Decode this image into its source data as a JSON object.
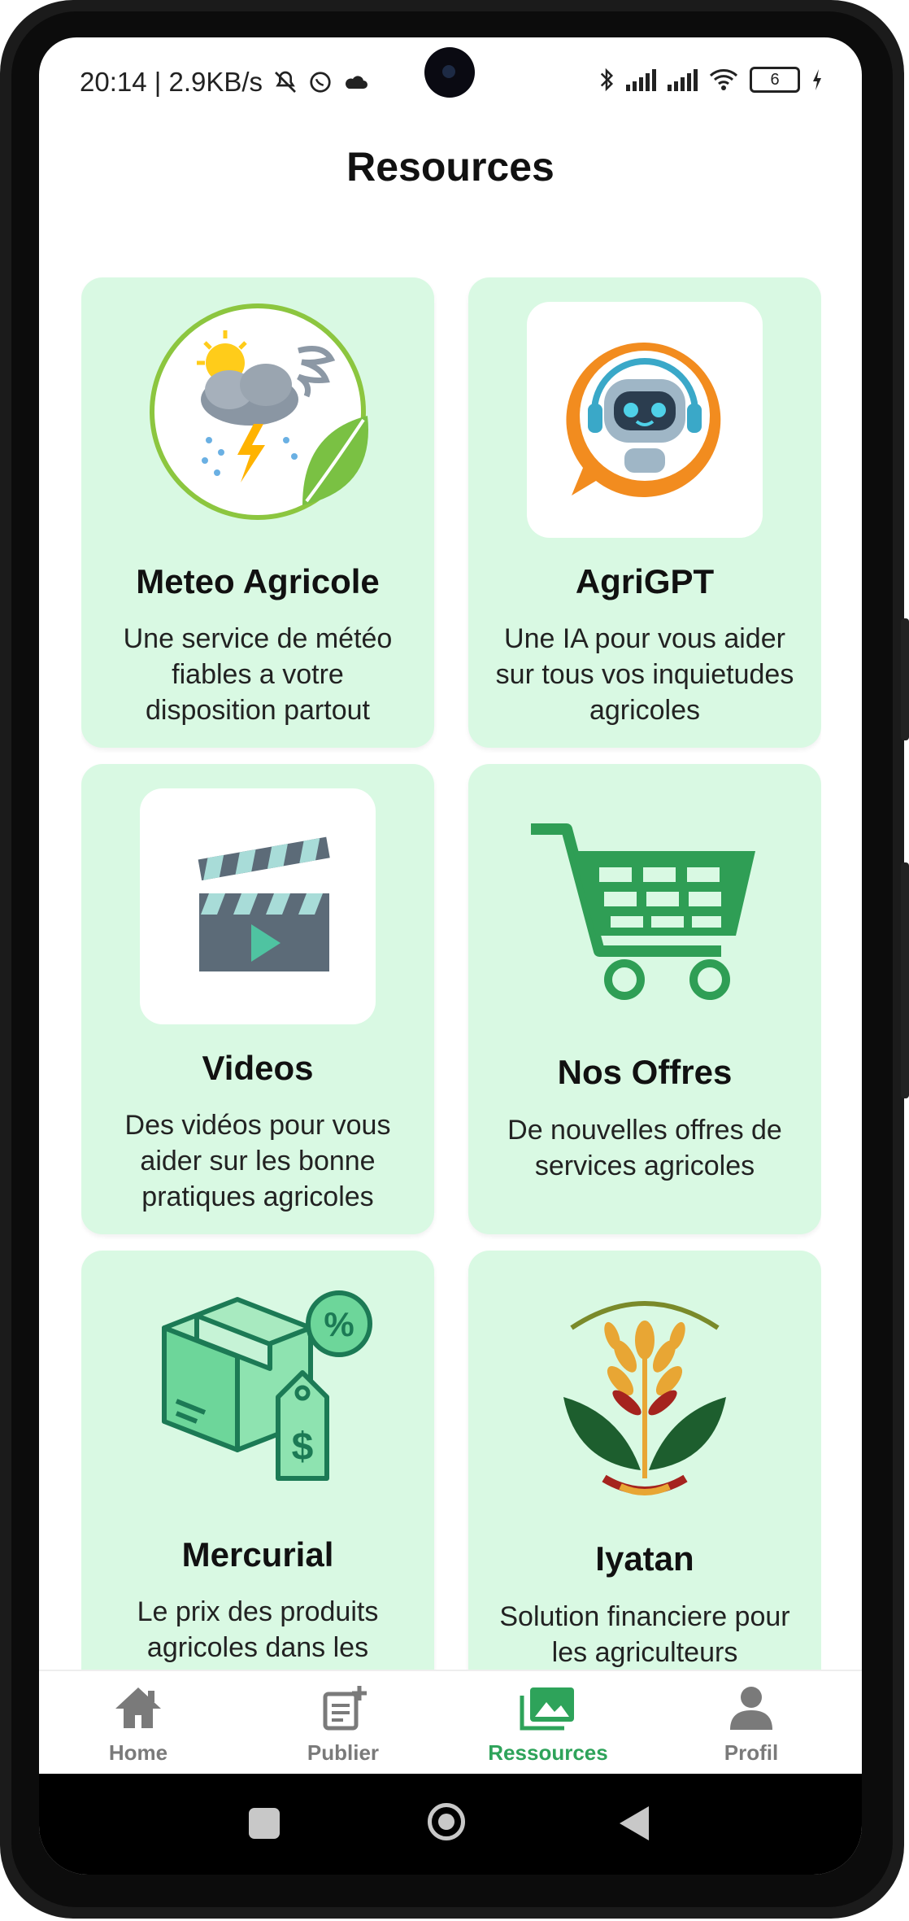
{
  "status_bar": {
    "time_speed": "20:14 | 2.9KB/s",
    "battery": "6",
    "icons": [
      "mute-icon",
      "whatsapp-icon",
      "cloud-icon",
      "bluetooth-icon",
      "signal-icon",
      "signal-icon",
      "wifi-icon",
      "battery-icon",
      "charging-icon"
    ]
  },
  "header": {
    "title": "Resources"
  },
  "cards": [
    {
      "title": "Meteo Agricole",
      "desc": "Une service de météo fiables a votre disposition partout",
      "icon": "weather-leaf-icon"
    },
    {
      "title": "AgriGPT",
      "desc": "Une IA pour vous aider sur tous vos inquietudes agricoles",
      "icon": "robot-assistant-icon"
    },
    {
      "title": "Videos",
      "desc": "Des vidéos pour vous aider sur les bonne pratiques agricoles",
      "icon": "clapperboard-icon"
    },
    {
      "title": "Nos Offres",
      "desc": "De nouvelles offres de services agricoles",
      "icon": "shopping-cart-icon"
    },
    {
      "title": "Mercurial",
      "desc": "Le prix des produits agricoles dans les marchés publics",
      "icon": "package-price-icon"
    },
    {
      "title": "Iyatan",
      "desc": "Solution financiere pour les agriculteurs",
      "icon": "wheat-logo-icon"
    }
  ],
  "bottom_nav": {
    "items": [
      {
        "label": "Home",
        "icon": "home-icon"
      },
      {
        "label": "Publier",
        "icon": "post-add-icon"
      },
      {
        "label": "Ressources",
        "icon": "photo-library-icon",
        "active": true
      },
      {
        "label": "Profil",
        "icon": "person-icon"
      }
    ]
  },
  "colors": {
    "card_bg": "#d9f9e3",
    "accent": "#2ea35a",
    "nav_inactive": "#7a7a7a"
  }
}
